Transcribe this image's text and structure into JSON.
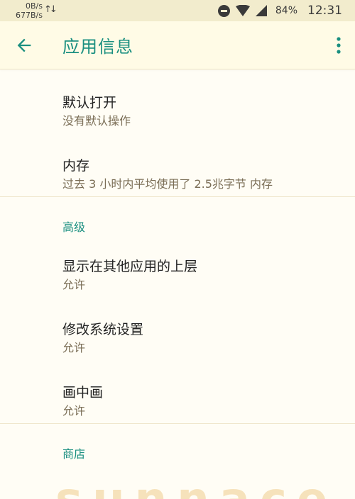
{
  "status_bar": {
    "net_up": "0B/s",
    "net_down": "677B/s",
    "battery": "84%",
    "time": "12:31"
  },
  "app_bar": {
    "title": "应用信息",
    "back_icon": "arrow-left-icon",
    "more_icon": "more-vert-icon"
  },
  "items": [
    {
      "title": "默认打开",
      "subtitle": "没有默认操作"
    },
    {
      "title": "内存",
      "subtitle": "过去 3 小时内平均使用了 2.5兆字节 内存"
    }
  ],
  "advanced": {
    "header": "高级",
    "items": [
      {
        "title": "显示在其他应用的上层",
        "subtitle": "允许"
      },
      {
        "title": "修改系统设置",
        "subtitle": "允许"
      },
      {
        "title": "画中画",
        "subtitle": "允许"
      }
    ]
  },
  "store": {
    "header": "商店"
  },
  "watermark": "sunnace",
  "colors": {
    "accent": "#1a8f80",
    "subtitle": "#7a6d55",
    "background": "#fffdf5"
  }
}
